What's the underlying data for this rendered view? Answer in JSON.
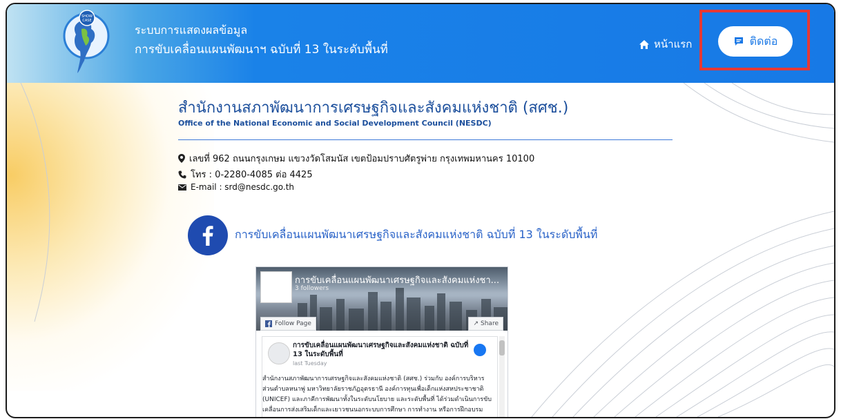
{
  "header": {
    "title_line1": "ระบบการแสดงผลข้อมูล",
    "title_line2": "การขับเคลื่อนแผนพัฒนาฯ ฉบับที่ 13 ในระดับพื้นที่",
    "logo_text": "SHOW CASE",
    "nav": {
      "home_label": "หน้าแรก",
      "contact_label": "ติดต่อ"
    }
  },
  "organization": {
    "name_th": "สำนักงานสภาพัฒนาการเศรษฐกิจและสังคมแห่งชาติ (สศช.)",
    "name_en": "Office of the National Economic and Social Development Council (NESDC)",
    "address": "เลขที่ 962 ถนนกรุงเกษม แขวงวัดโสมนัส เขตป้อมปราบศัตรูพ่าย กรุงเทพมหานคร 10100",
    "phone": "โทร : 0-2280-4085 ต่อ 4425",
    "email": "E-mail : srd@nesdc.go.th"
  },
  "facebook": {
    "link_text": "การขับเคลื่อนแผนพัฒนาเศรษฐกิจและสังคมแห่งชาติ ฉบับที่ 13 ในระดับพื้นที่",
    "widget": {
      "page_name": "การขับเคลื่อนแผนพัฒนาเศรษฐกิจและสังคมแห่งชา...",
      "followers": "3 followers",
      "follow_label": "Follow Page",
      "share_label": "Share",
      "post_title": "การขับเคลื่อนแผนพัฒนาเศรษฐกิจและสังคมแห่งชาติ ฉบับที่ 13 ในระดับพื้นที่",
      "post_date": "last Tuesday",
      "post_body": "สำนักงานสภาพัฒนาการเศรษฐกิจและสังคมแห่งชาติ (สศช.) ร่วมกับ องค์การบริหารส่วนตำบลหนาพู่ มหาวิทยาลัยราชภัฏอุตรธานี องค์การทุนเพื่อเด็กแห่งสหประชาชาติ (UNICEF) และภาคีการพัฒนาทั้งในระดับนโยบาย และระดับพื้นที่ ได้ร่วมดำเนินการขับเคลื่อนการส่งเสริมเด็กและเยาวชนนอกระบบการศึกษา การทำงาน หรือการฝึกอบรม (Youth Not in Education, Employment,"
    }
  },
  "colors": {
    "header_blue": "#1779e6",
    "title_blue": "#1c4f9c",
    "link_blue": "#2a63c8",
    "highlight_red": "#e53935"
  }
}
